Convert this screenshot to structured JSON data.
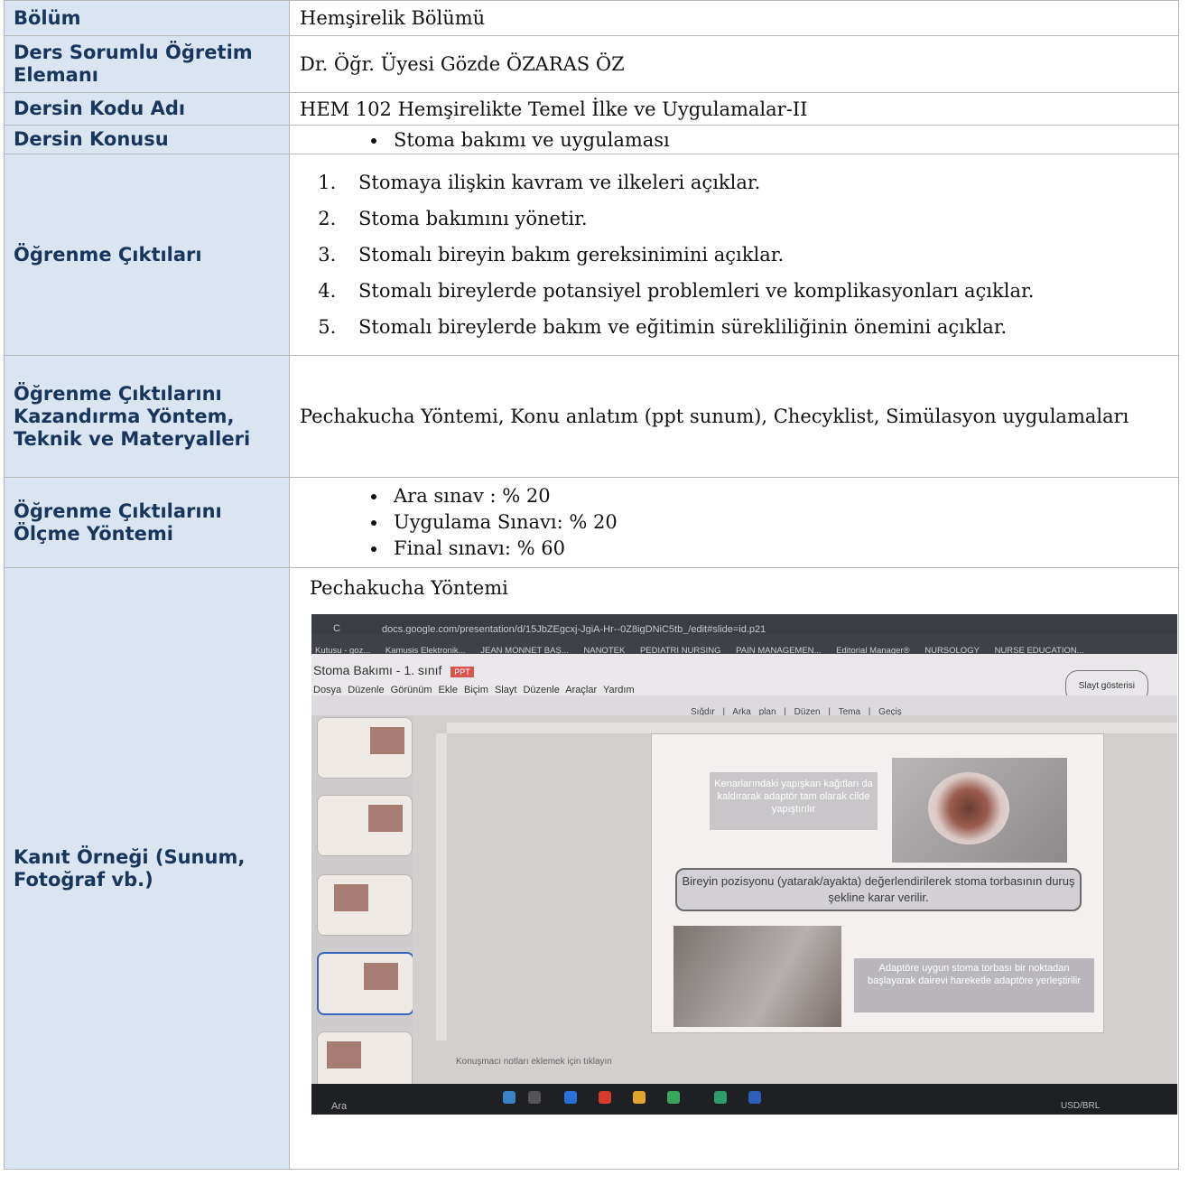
{
  "rows": {
    "bolum": {
      "label": "Bölüm",
      "value": "Hemşirelik Bölümü"
    },
    "ders_sorumlu": {
      "label": "Ders Sorumlu Öğretim Elemanı",
      "value": "Dr. Öğr. Üyesi Gözde ÖZARAS ÖZ"
    },
    "dersin_kodu": {
      "label": "Dersin Kodu Adı",
      "value": "HEM 102 Hemşirelikte Temel İlke ve Uygulamalar-II"
    },
    "dersin_konusu": {
      "label": "Dersin Konusu",
      "items": [
        "Stoma bakımı ve uygulaması"
      ]
    },
    "ogrenme_ciktilari": {
      "label": "Öğrenme Çıktıları",
      "items": [
        "Stomaya ilişkin kavram ve ilkeleri açıklar.",
        "Stoma bakımını yönetir.",
        "Stomalı bireyin bakım gereksinimini açıklar.",
        "Stomalı bireylerde potansiyel problemleri ve komplikasyonları açıklar.",
        "Stomalı bireylerde bakım ve eğitimin sürekliliğinin önemini açıklar."
      ]
    },
    "kazandirma": {
      "label": "Öğrenme Çıktılarını Kazandırma Yöntem, Teknik ve Materyalleri",
      "value": "Pechakucha Yöntemi, Konu anlatım (ppt sunum), Checyklist, Simülasyon uygulamaları"
    },
    "olcme": {
      "label": "Öğrenme Çıktılarını Ölçme Yöntemi",
      "items": [
        "Ara sınav : % 20",
        "Uygulama Sınavı: % 20",
        "Final sınavı: % 60"
      ]
    },
    "kanit": {
      "label": "Kanıt Örneği (Sunum, Fotoğraf vb.)",
      "title": "Pechakucha Yöntemi"
    }
  },
  "photo": {
    "url": "docs.google.com/presentation/d/15JbZEgcxj-JgiA-Hr--0Z8igDNiC5tb_/edit#slide=id.p21",
    "bookmarks": [
      "Kutusu - goz...",
      "Kamusis Elektronik...",
      "JEAN MONNET BAŞ...",
      "NANOTEK",
      "PEDIATRI NURSING",
      "PAIN MANAGEMEN...",
      "Editorial Manager®",
      "NURSOLOGY",
      "NURSE EDUCATION..."
    ],
    "doc_title": "Stoma Bakımı - 1. sınıf",
    "doc_badge": "PPT",
    "menu": "Dosya Düzenle Görünüm Ekle Biçim Slayt Düzenle Araçlar Yardım",
    "slide_show": "Slayt gösterisi",
    "toolbar": "Sığdır | Arka plan | Düzen | Tema | Geçiş",
    "box1": "Kenarlarındaki yapışkan kağıtları da kaldırarak adaptör tam olarak cilde yapıştırılır",
    "pill": "Bireyin pozisyonu (yatarak/ayakta) değerlendirilerek stoma torbasının duruş şekline karar verilir.",
    "box2": "Adaptöre uygun stoma torbası bir noktadan başlayarak dairevi hareketle adaptöre yerleştirilir",
    "notes": "Konuşmacı notları eklemek için tıklayın",
    "taskbar_search": "Ara",
    "taskbar_currency": "USD/BRL"
  }
}
